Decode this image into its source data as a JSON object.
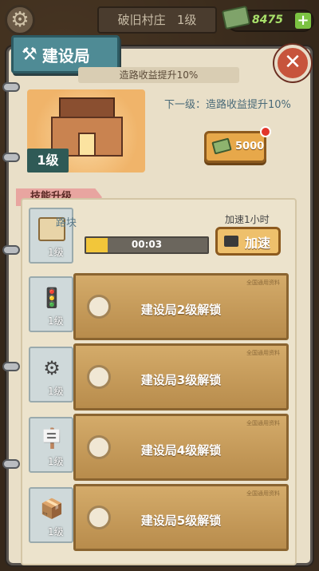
{
  "hud": {
    "village_name": "破旧村庄",
    "village_level": "1级",
    "money": "8475",
    "plus_symbol": "+",
    "gear_symbol": "⚙"
  },
  "panel": {
    "title": "建设局",
    "close_symbol": "✕",
    "current_effect": "造路收益提升10%",
    "level_badge": "1级",
    "next_level": "下一级：造路收益提升10%",
    "upgrade_price": "5000"
  },
  "skills": {
    "section_title": "技能升级",
    "active": {
      "name": "路块",
      "level": "1级",
      "timer": "00:03",
      "progress": 0.18,
      "speed_hint": "加速1小时",
      "speed_button": "加速"
    },
    "locked": [
      {
        "level": "1级",
        "label": "建设局2级解锁",
        "stamp": "全国通用资料"
      },
      {
        "level": "1级",
        "label": "建设局3级解锁",
        "stamp": "全国通用资料"
      },
      {
        "level": "1级",
        "label": "建设局4级解锁",
        "stamp": "全国通用资料"
      },
      {
        "level": "1级",
        "label": "建设局5级解锁",
        "stamp": "全国通用资料"
      }
    ]
  }
}
